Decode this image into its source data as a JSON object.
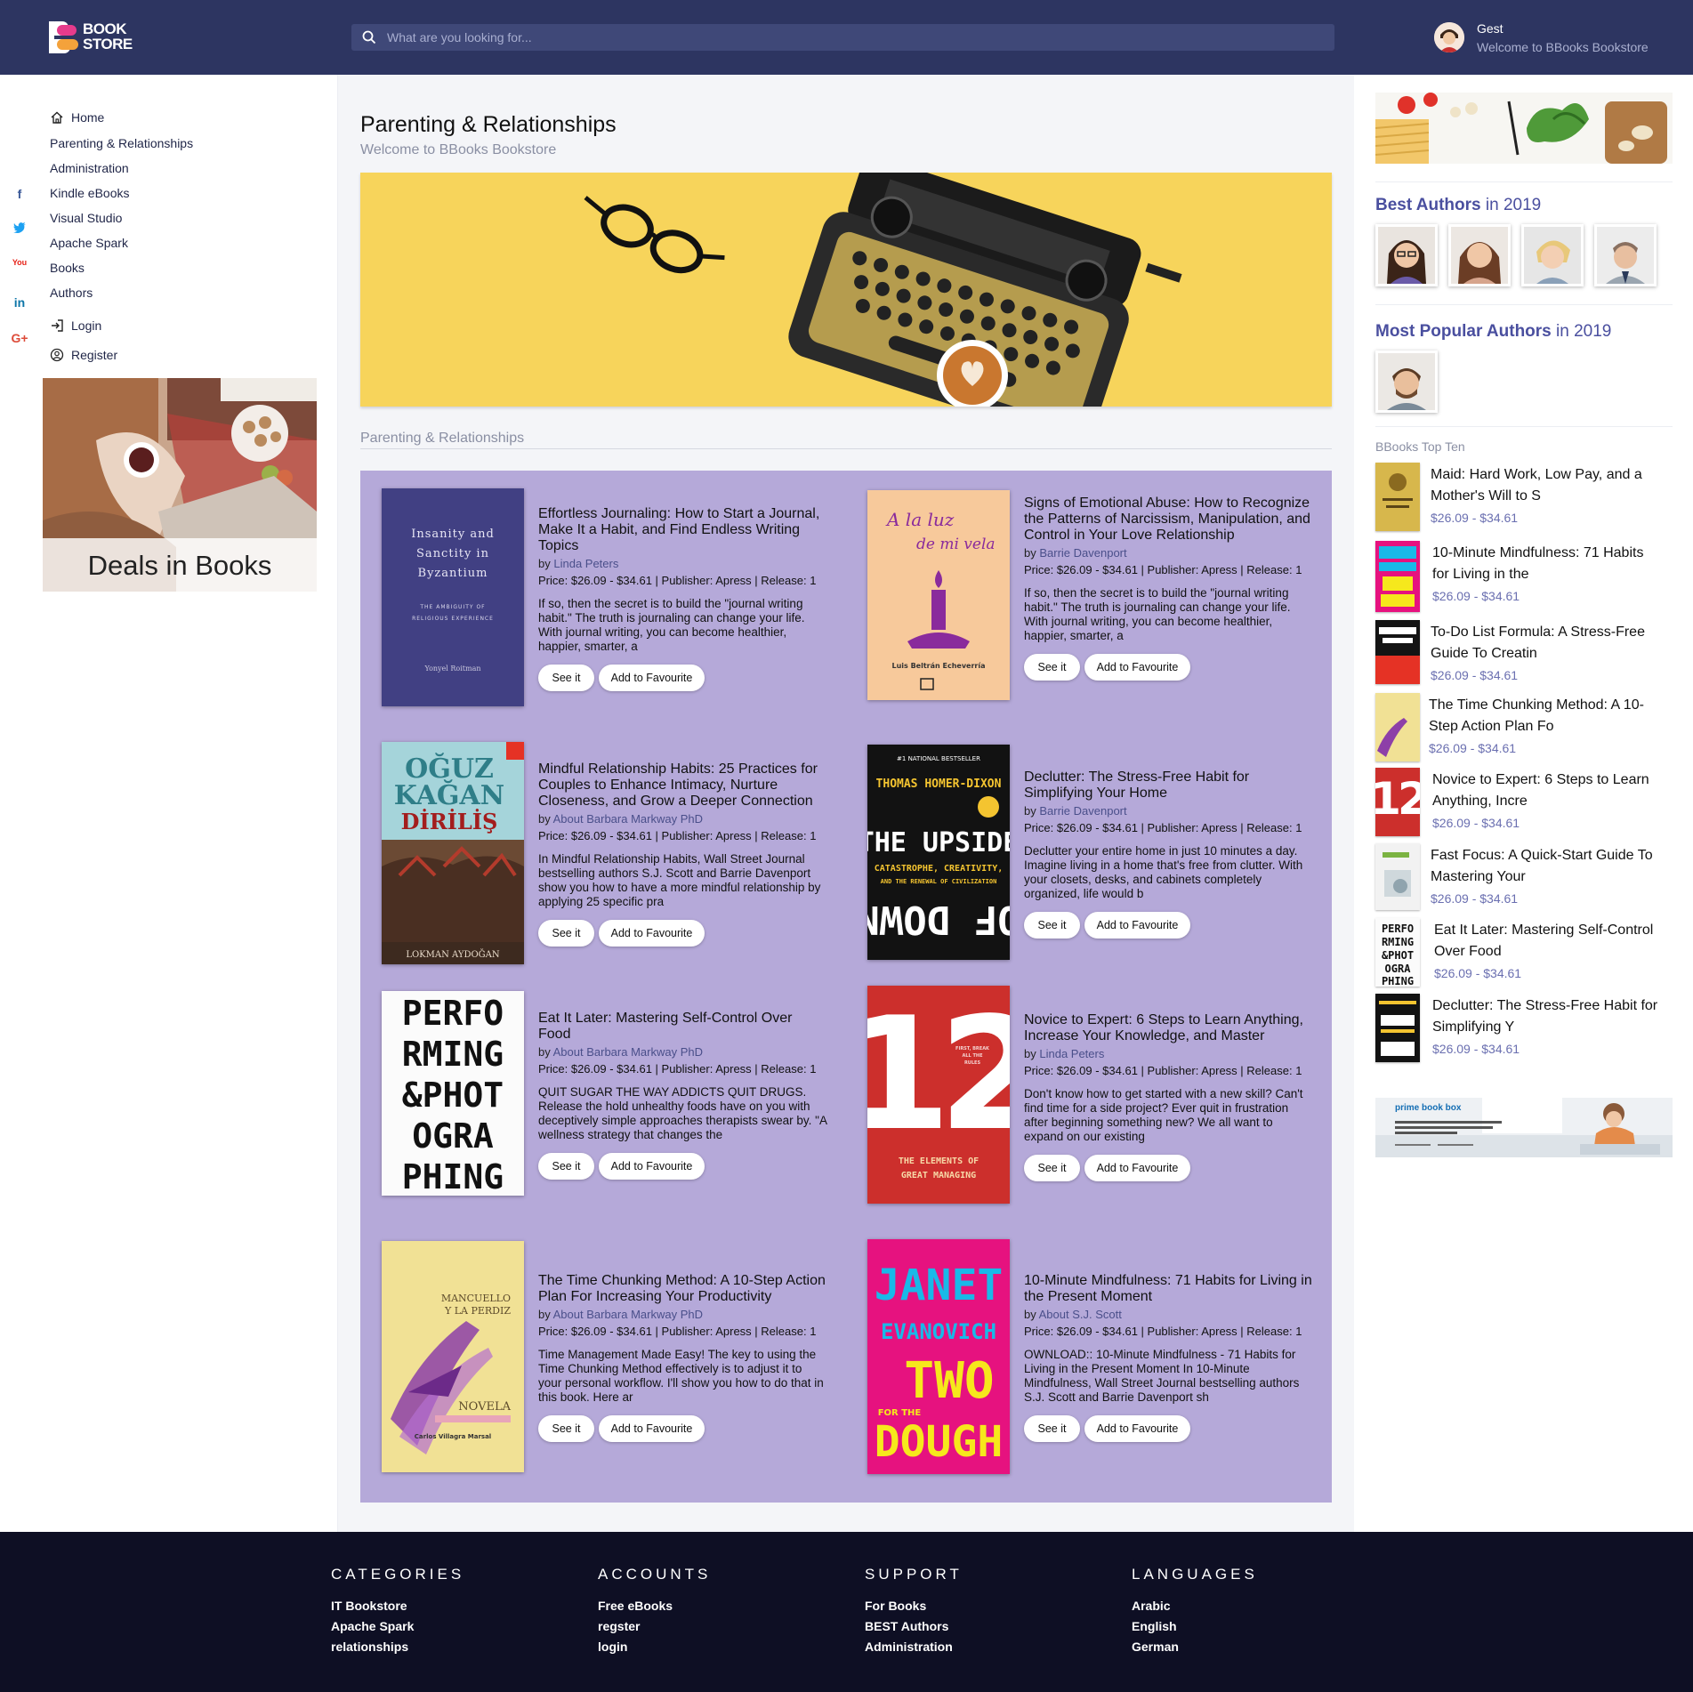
{
  "header": {
    "logo_line1": "BOOK",
    "logo_line2": "STORE",
    "search_placeholder": "What are you looking for...",
    "user_name": "Gest",
    "user_welcome": "Welcome to BBooks Bookstore"
  },
  "social": [
    "f",
    "t",
    "You",
    "in",
    "G+"
  ],
  "sidebar": {
    "items": [
      {
        "label": "Home",
        "icon": "home-icon"
      },
      {
        "label": "Parenting & Relationships"
      },
      {
        "label": "Administration"
      },
      {
        "label": "Kindle eBooks"
      },
      {
        "label": "Visual Studio"
      },
      {
        "label": "Apache Spark"
      },
      {
        "label": "Books"
      },
      {
        "label": "Authors"
      },
      {
        "label": "Login",
        "icon": "login-icon"
      },
      {
        "label": "Register",
        "icon": "user-circle-icon"
      }
    ],
    "deals_label": "Deals in Books"
  },
  "main": {
    "title": "Parenting & Relationships",
    "subtitle": "Welcome to BBooks Bookstore",
    "section_title": "Parenting & Relationships",
    "see_label": "See it",
    "fav_label": "Add to Favourite",
    "by_prefix": "by",
    "books": [
      {
        "title": "Effortless Journaling: How to Start a Journal, Make It a Habit, and Find Endless Writing Topics",
        "author": "Linda Peters",
        "price": "Price: $26.09 - $34.61 | Publisher: Apress | Release: 1",
        "desc": "If so, then the secret is to build the \"journal writing habit.\" The truth is journaling can change your life. With journal writing, you can become healthier, happier, smarter, a",
        "cover_lines": [
          "Insanity and",
          "Sanctity in",
          "Byzantium",
          "THE AMBIGUITY OF",
          "RELIGIOUS EXPERIENCE",
          "Yonyel Roitman"
        ]
      },
      {
        "title": "Signs of Emotional Abuse: How to Recognize the Patterns of Narcissism, Manipulation, and Control in Your Love Relationship",
        "author": "Barrie Davenport",
        "price": "Price: $26.09 - $34.61 | Publisher: Apress | Release: 1",
        "desc": "If so, then the secret is to build the \"journal writing habit.\" The truth is journaling can change your life. With journal writing, you can become healthier, happier, smarter, a",
        "cover_lines": [
          "A la luz",
          "de mi vela",
          "Luis Beltrán Echeverría"
        ]
      },
      {
        "title": "Mindful Relationship Habits: 25 Practices for Couples to Enhance Intimacy, Nurture Closeness, and Grow a Deeper Connection",
        "author": "About Barbara Markway PhD",
        "price": "Price: $26.09 - $34.61 | Publisher: Apress | Release: 1",
        "desc": "In Mindful Relationship Habits, Wall Street Journal bestselling authors S.J. Scott and Barrie Davenport show you how to have a more mindful relationship by applying 25 specific pra",
        "cover_lines": [
          "OĞUZ",
          "KAĞAN",
          "DİRİLİŞ",
          "LOKMAN AYDOĞAN"
        ]
      },
      {
        "title": "Declutter: The Stress-Free Habit for Simplifying Your Home",
        "author": "Barrie Davenport",
        "price": "Price: $26.09 - $34.61 | Publisher: Apress | Release: 1",
        "desc": "Declutter your entire home in just 10 minutes a day. Imagine living in a home that's free from clutter. With your closets, desks, and cabinets completely organized, life would b",
        "cover_lines": [
          "#1 NATIONAL BESTSELLER",
          "THOMAS HOMER-DIXON",
          "THE UPSIDE",
          "CATASTROPHE, CREATIVITY,",
          "AND THE RENEWAL OF CIVILIZATION",
          "OF DOWN"
        ]
      },
      {
        "title": "Eat It Later: Mastering Self-Control Over Food",
        "author": "About Barbara Markway PhD",
        "price": "Price: $26.09 - $34.61 | Publisher: Apress | Release: 1",
        "desc": "QUIT SUGAR THE WAY ADDICTS QUIT DRUGS. Release the hold unhealthy foods have on you with deceptively simple approaches therapists swear by. \"A wellness strategy that changes the",
        "cover_lines": [
          "PERFO",
          "RMING",
          "&PHOT",
          "OGRA",
          "PHING"
        ]
      },
      {
        "title": "Novice to Expert: 6 Steps to Learn Anything, Increase Your Knowledge, and Master",
        "author": "Linda Peters",
        "price": "Price: $26.09 - $34.61 | Publisher: Apress | Release: 1",
        "desc": "Don't know how to get started with a new skill? Can't find time for a side project? Ever quit in frustration after beginning something new? We all want to expand on our existing",
        "cover_lines": [
          "12",
          "FIRST, BREAK",
          "ALL THE",
          "RULES",
          "THE ELEMENTS OF",
          "GREAT MANAGING"
        ]
      },
      {
        "title": "The Time Chunking Method: A 10-Step Action Plan For Increasing Your Productivity",
        "author": "About Barbara Markway PhD",
        "price": "Price: $26.09 - $34.61 | Publisher: Apress | Release: 1",
        "desc": "Time Management Made Easy! The key to using the Time Chunking Method effectively is to adjust it to your personal workflow. I'll show you how to do that in this book. Here ar",
        "cover_lines": [
          "MANCUELLO",
          "Y LA PERDIZ",
          "NOVELA",
          "Carlos Villagra Marsal"
        ]
      },
      {
        "title": "10-Minute Mindfulness: 71 Habits for Living in the Present Moment",
        "author": "About S.J. Scott",
        "price": "Price: $26.09 - $34.61 | Publisher: Apress | Release: 1",
        "desc": "OWNLOAD:: 10-Minute Mindfulness - 71 Habits for Living in the Present Moment In 10-Minute Mindfulness, Wall Street Journal bestselling authors S.J. Scott and Barrie Davenport sh",
        "cover_lines": [
          "JANET",
          "EVANOVICH",
          "TWO",
          "FOR THE",
          "DOUGH"
        ]
      }
    ]
  },
  "right": {
    "best_authors": "Best Authors",
    "best_year": " in 2019",
    "popular_authors": "Most Popular Authors",
    "popular_year": " in 2019",
    "topten_title": "BBooks Top Ten",
    "prime_label": "prime book box",
    "topten": [
      {
        "title": "Maid: Hard Work, Low Pay, and a Mother's Will to S",
        "price": "$26.09 - $34.61"
      },
      {
        "title": "10-Minute Mindfulness: 71 Habits for Living in the",
        "price": "$26.09 - $34.61"
      },
      {
        "title": "To-Do List Formula: A Stress-Free Guide To Creatin",
        "price": "$26.09 - $34.61"
      },
      {
        "title": "The Time Chunking Method: A 10-Step Action Plan Fo",
        "price": "$26.09 - $34.61"
      },
      {
        "title": "Novice to Expert: 6 Steps to Learn Anything, Incre",
        "price": "$26.09 - $34.61"
      },
      {
        "title": "Fast Focus: A Quick-Start Guide To Mastering Your",
        "price": "$26.09 - $34.61"
      },
      {
        "title": "Eat It Later: Mastering Self-Control Over Food",
        "price": "$26.09 - $34.61"
      },
      {
        "title": "Declutter: The Stress-Free Habit for Simplifying Y",
        "price": "$26.09 - $34.61"
      }
    ]
  },
  "footer": {
    "columns": [
      {
        "heading": "CATEGORIES",
        "links": [
          "IT Bookstore",
          "Apache Spark",
          "relationships"
        ]
      },
      {
        "heading": "ACCOUNTS",
        "links": [
          "Free eBooks",
          "regster",
          "login"
        ]
      },
      {
        "heading": "SUPPORT",
        "links": [
          "For Books",
          "BEST Authors",
          "Administration"
        ]
      },
      {
        "heading": "LANGUAGES",
        "links": [
          "Arabic",
          "English",
          "German"
        ]
      }
    ]
  }
}
